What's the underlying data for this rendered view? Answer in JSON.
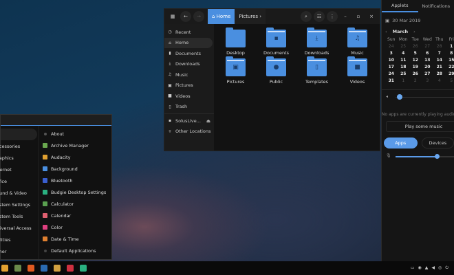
{
  "file_manager": {
    "breadcrumbs": [
      "Home",
      "Pictures"
    ],
    "sidebar": [
      {
        "label": "Recent",
        "icon": "clock-icon"
      },
      {
        "label": "Home",
        "icon": "home-icon",
        "active": true
      },
      {
        "label": "Documents",
        "icon": "document-icon"
      },
      {
        "label": "Downloads",
        "icon": "download-icon"
      },
      {
        "label": "Music",
        "icon": "music-icon"
      },
      {
        "label": "Pictures",
        "icon": "picture-icon"
      },
      {
        "label": "Videos",
        "icon": "video-icon"
      },
      {
        "label": "Trash",
        "icon": "trash-icon"
      },
      {
        "label": "SolusLive...",
        "icon": "drive-icon"
      },
      {
        "label": "Other Locations",
        "icon": "plus-icon"
      }
    ],
    "folders": [
      {
        "label": "Desktop",
        "icon": ""
      },
      {
        "label": "Documents",
        "icon": "▪"
      },
      {
        "label": "Downloads",
        "icon": "⤓"
      },
      {
        "label": "Music",
        "icon": "♫"
      },
      {
        "label": "Pictures",
        "icon": "▣"
      },
      {
        "label": "Public",
        "icon": "●"
      },
      {
        "label": "Templates",
        "icon": "▯"
      },
      {
        "label": "Videos",
        "icon": "■"
      }
    ]
  },
  "raven": {
    "tabs": [
      "Applets",
      "Notifications"
    ],
    "date": "30 Mar 2019",
    "month": "March",
    "weekdays": [
      "Sun",
      "Mon",
      "Tue",
      "Wed",
      "Thu",
      "Fri"
    ],
    "weeks": [
      [
        "24",
        "25",
        "26",
        "27",
        "28",
        "1"
      ],
      [
        "3",
        "4",
        "5",
        "6",
        "7",
        "8"
      ],
      [
        "10",
        "11",
        "12",
        "13",
        "14",
        "15"
      ],
      [
        "17",
        "18",
        "19",
        "20",
        "21",
        "22"
      ],
      [
        "24",
        "25",
        "26",
        "27",
        "28",
        "29"
      ],
      [
        "31",
        "1",
        "2",
        "3",
        "4",
        "5"
      ]
    ],
    "no_apps": "No apps are currently playing audio",
    "play_music": "Play some music",
    "apps_tab": "Apps",
    "devices_tab": "Devices",
    "volume": 0.05,
    "mic_level": 0.7,
    "accent": "#4a8fe0"
  },
  "menu": {
    "categories": [
      "Accessories",
      "Graphics",
      "Internet",
      "Office",
      "Sound & Video",
      "System Settings",
      "System Tools",
      "Universal Access",
      "Utilities",
      "Other"
    ],
    "apps": [
      {
        "label": "About",
        "color": "#555"
      },
      {
        "label": "Archive Manager",
        "color": "#6aa84f"
      },
      {
        "label": "Audacity",
        "color": "#e0a030"
      },
      {
        "label": "Background",
        "color": "#4a8fe0"
      },
      {
        "label": "Bluetooth",
        "color": "#3a5fd0"
      },
      {
        "label": "Budgie Desktop Settings",
        "color": "#2ab080"
      },
      {
        "label": "Calculator",
        "color": "#5aa050"
      },
      {
        "label": "Calendar",
        "color": "#e06070"
      },
      {
        "label": "Color",
        "color": "#e04080"
      },
      {
        "label": "Date & Time",
        "color": "#e08030"
      },
      {
        "label": "Default Applications",
        "color": "#444"
      }
    ]
  },
  "taskbar": {
    "apps": [
      {
        "name": "menu",
        "color": "#e0a030"
      },
      {
        "name": "files",
        "color": "#6a8a4a"
      },
      {
        "name": "firefox",
        "color": "#e05a20"
      },
      {
        "name": "app",
        "color": "#2a6ab0"
      },
      {
        "name": "rhythmbox",
        "color": "#d0a040"
      },
      {
        "name": "software",
        "color": "#d03040"
      },
      {
        "name": "budgie",
        "color": "#2ab080"
      }
    ]
  }
}
